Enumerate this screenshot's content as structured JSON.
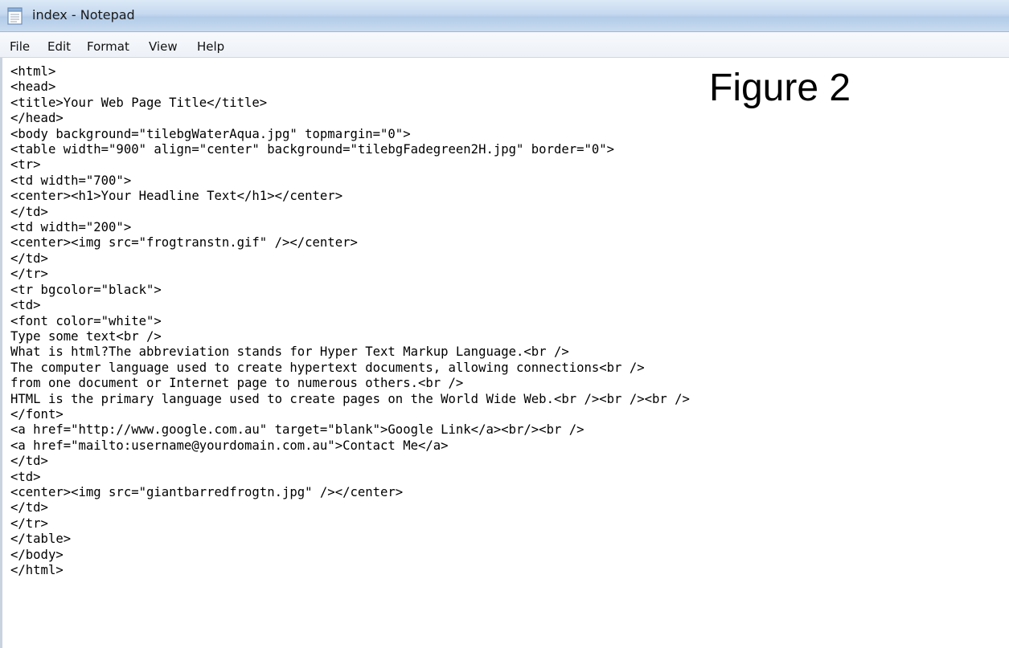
{
  "window": {
    "title": "index - Notepad",
    "icon": "notepad-icon"
  },
  "menu": {
    "items": [
      "File",
      "Edit",
      "Format",
      "View",
      "Help"
    ]
  },
  "editor": {
    "lines": [
      "<html>",
      "<head>",
      "<title>Your Web Page Title</title>",
      "</head>",
      "<body background=\"tilebgWaterAqua.jpg\" topmargin=\"0\">",
      "<table width=\"900\" align=\"center\" background=\"tilebgFadegreen2H.jpg\" border=\"0\">",
      "<tr>",
      "<td width=\"700\">",
      "<center><h1>Your Headline Text</h1></center>",
      "</td>",
      "<td width=\"200\">",
      "<center><img src=\"frogtranstn.gif\" /></center>",
      "</td>",
      "</tr>",
      "<tr bgcolor=\"black\">",
      "<td>",
      "<font color=\"white\">",
      "Type some text<br />",
      "What is html?The abbreviation stands for Hyper Text Markup Language.<br />",
      "The computer language used to create hypertext documents, allowing connections<br />",
      "from one document or Internet page to numerous others.<br />",
      "HTML is the primary language used to create pages on the World Wide Web.<br /><br /><br />",
      "</font>",
      "<a href=\"http://www.google.com.au\" target=\"blank\">Google Link</a><br/><br />",
      "<a href=\"mailto:username@yourdomain.com.au\">Contact Me</a>",
      "</td>",
      "<td>",
      "<center><img src=\"giantbarredfrogtn.jpg\" /></center>",
      "</td>",
      "</tr>",
      "</table>",
      "</body>",
      "</html>"
    ]
  },
  "overlay": {
    "label": "Figure 2"
  }
}
